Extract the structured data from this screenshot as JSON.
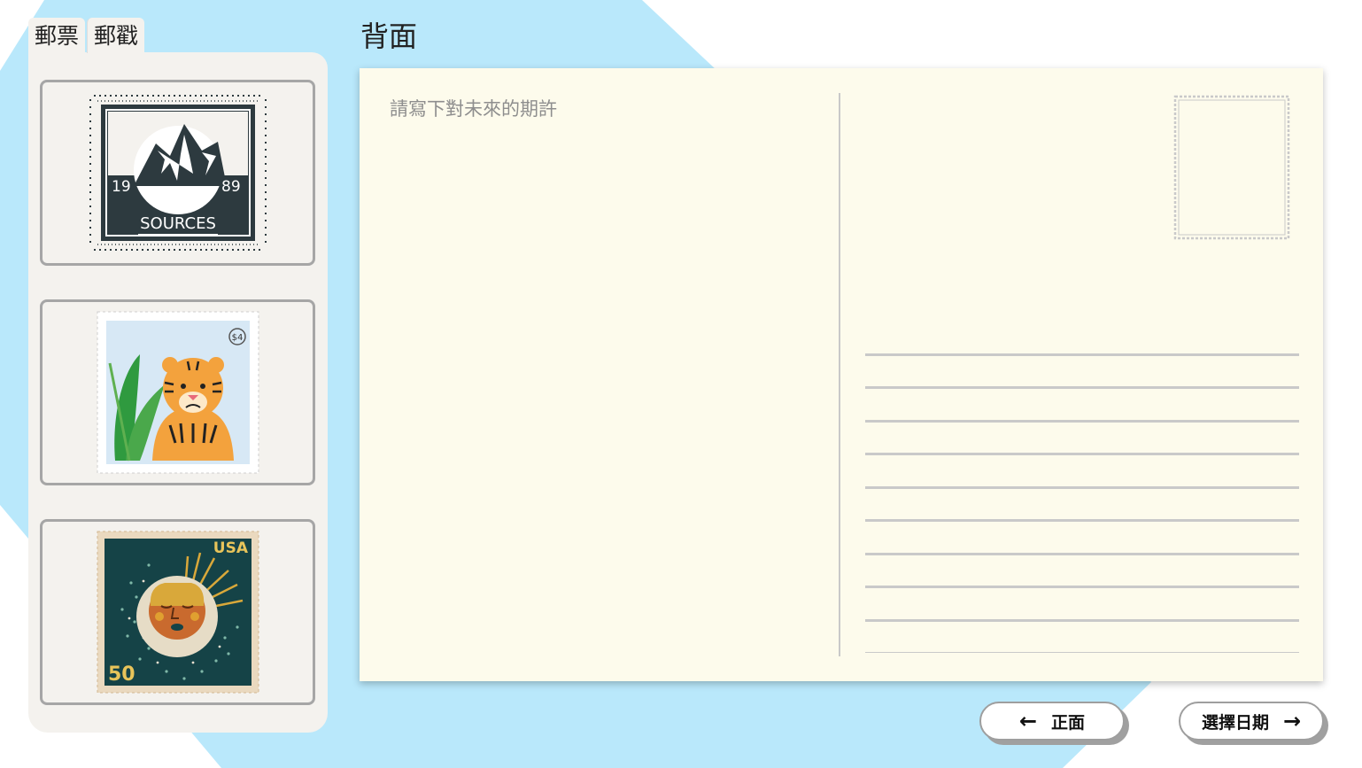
{
  "tabs": [
    {
      "label": "郵票"
    },
    {
      "label": "郵戳"
    }
  ],
  "page_title": "背面",
  "stamps": [
    {
      "name": "mountain-stamp",
      "label_left": "19",
      "label_right": "89",
      "label": "SOURCES"
    },
    {
      "name": "tiger-stamp",
      "value_label": "$4"
    },
    {
      "name": "sun-stamp",
      "country": "USA",
      "value": "50"
    }
  ],
  "postcard": {
    "message_placeholder": "請寫下對未來的期許",
    "message_value": ""
  },
  "buttons": {
    "front_label": "正面",
    "select_date_label": "選擇日期"
  },
  "colors": {
    "background_hex": "#b9e8fb",
    "sidebar": "#f4f2ee",
    "postcard": "#fdfbec",
    "line": "#c9c9c9"
  }
}
